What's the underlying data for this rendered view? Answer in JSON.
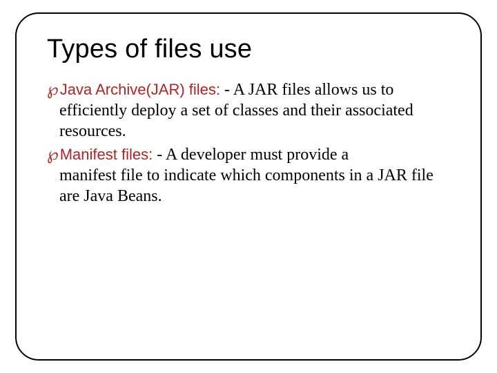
{
  "title": "Types of files use",
  "items": [
    {
      "label": "Java Archive(JAR) files:",
      "text_first": "- A JAR files allows us to",
      "text_rest": "efficiently deploy a set of classes and their associated resources."
    },
    {
      "label": "Manifest files:",
      "text_first": "- A developer must provide a",
      "text_rest": "manifest file to indicate which components in a JAR file are Java Beans."
    }
  ],
  "bullet_glyph": "℘"
}
